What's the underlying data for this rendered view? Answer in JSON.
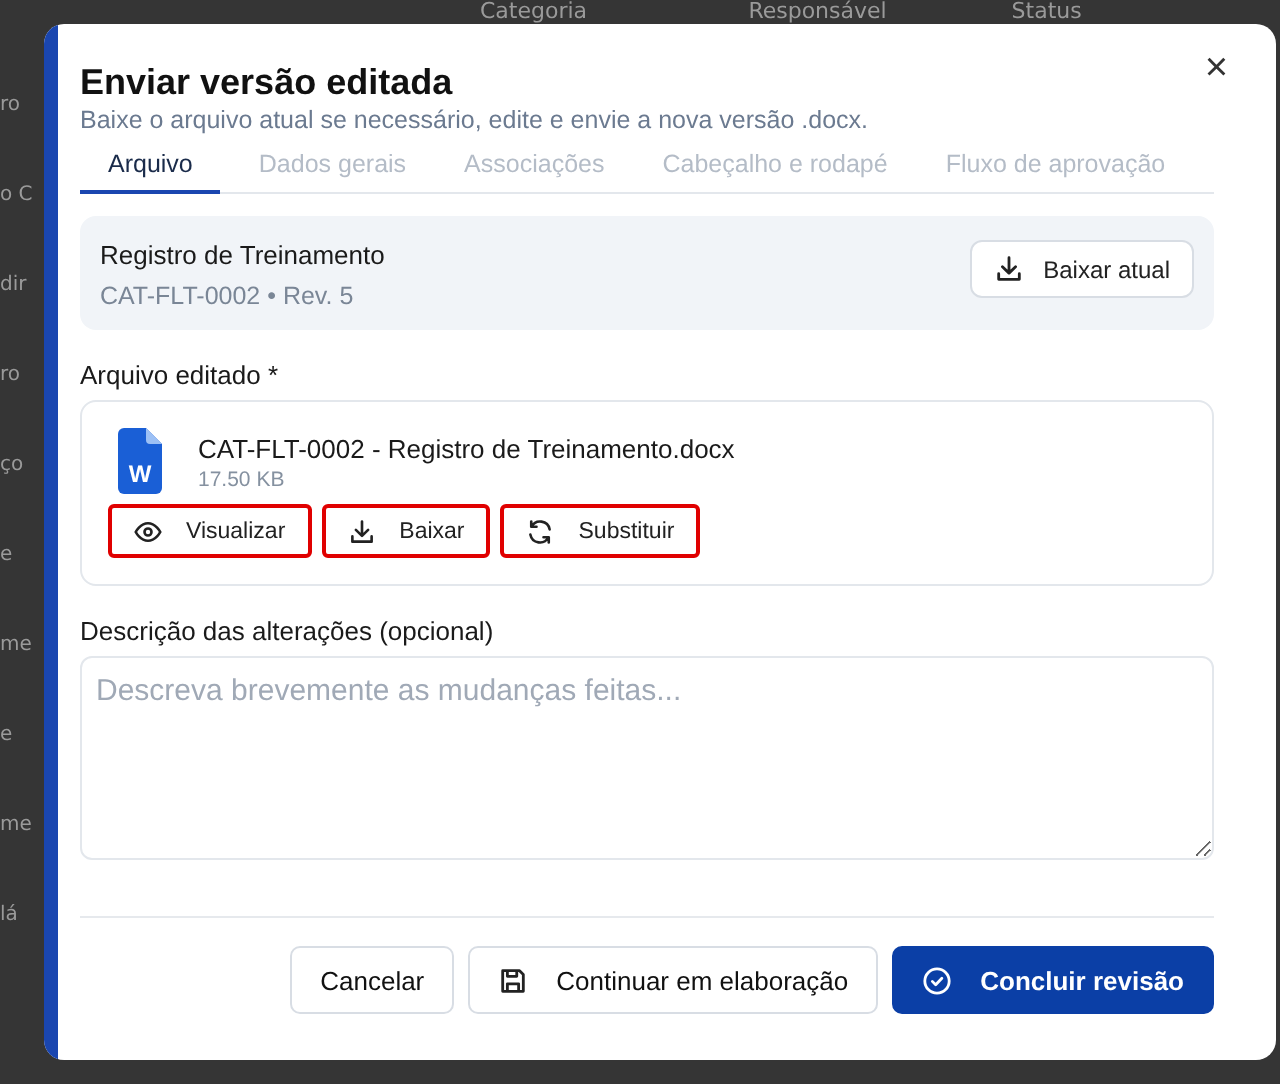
{
  "background": {
    "table_headers": [
      "Categoria",
      "Responsável",
      "Status"
    ],
    "row_fragments": [
      "ro",
      "o C",
      "dir",
      "ro",
      "ço",
      "e",
      "me",
      "e",
      "me",
      "lá"
    ]
  },
  "dialog": {
    "title": "Enviar versão editada",
    "subtitle": "Baixe o arquivo atual se necessário, edite e envie a nova versão .docx.",
    "close": "×",
    "tabs": [
      {
        "label": "Arquivo",
        "selected": true
      },
      {
        "label": "Dados gerais",
        "selected": false
      },
      {
        "label": "Associações",
        "selected": false
      },
      {
        "label": "Cabeçalho e rodapé",
        "selected": false
      },
      {
        "label": "Fluxo de aprovação",
        "selected": false
      }
    ],
    "current": {
      "title": "Registro de Treinamento",
      "meta": "CAT-FLT-0002 • Rev. 5",
      "button": "Baixar atual"
    },
    "file_label": "Arquivo editado *",
    "file": {
      "name": "CAT-FLT-0002 - Registro de Treinamento.docx",
      "size": "17.50 KB",
      "badge": "W",
      "actions": [
        {
          "kind": "view",
          "label": "Visualizar",
          "highlighted": true
        },
        {
          "kind": "download",
          "label": "Baixar",
          "highlighted": true
        },
        {
          "kind": "replace",
          "label": "Substituir",
          "highlighted": true
        }
      ]
    },
    "description": {
      "label": "Descrição das alterações (opcional)",
      "placeholder": "Descreva brevemente as mudanças feitas..."
    },
    "footer": [
      {
        "kind": "plain",
        "label": "Cancelar"
      },
      {
        "kind": "save",
        "label": "Continuar em elaboração"
      },
      {
        "kind": "primary",
        "label": "Concluir revisão"
      }
    ]
  }
}
